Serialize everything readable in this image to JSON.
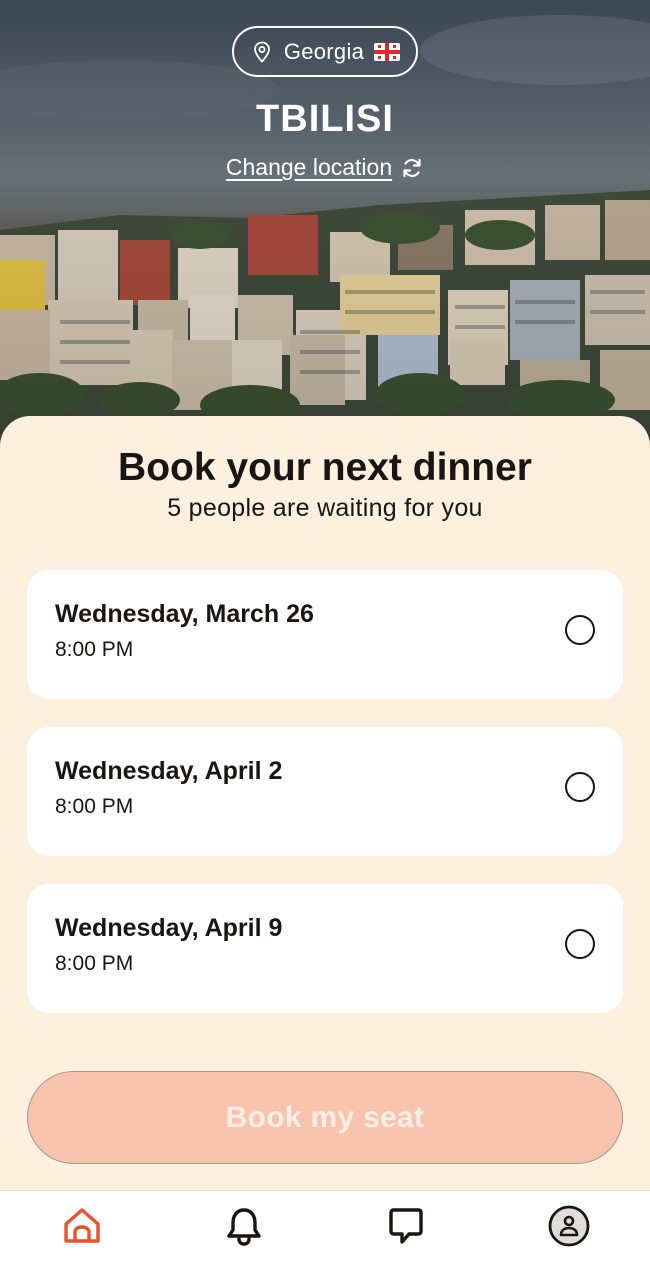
{
  "header": {
    "country": "Georgia",
    "city": "TBILISI",
    "change_location": "Change location"
  },
  "booking": {
    "title": "Book your next dinner",
    "subtitle": "5 people are waiting for you",
    "slots": [
      {
        "date": "Wednesday, March 26",
        "time": "8:00 PM",
        "selected": false
      },
      {
        "date": "Wednesday, April 2",
        "time": "8:00 PM",
        "selected": false
      },
      {
        "date": "Wednesday, April 9",
        "time": "8:00 PM",
        "selected": false
      }
    ],
    "button_label": "Book my seat"
  },
  "tabbar": {
    "items": [
      {
        "icon": "home-icon",
        "active": true
      },
      {
        "icon": "bell-icon",
        "active": false
      },
      {
        "icon": "chat-icon",
        "active": false
      },
      {
        "icon": "profile-icon",
        "active": false
      }
    ]
  },
  "colors": {
    "accent": "#e8532e",
    "sheet_bg": "#fdf0de",
    "button_disabled": "#f8c4ae",
    "text": "#1a1414"
  }
}
